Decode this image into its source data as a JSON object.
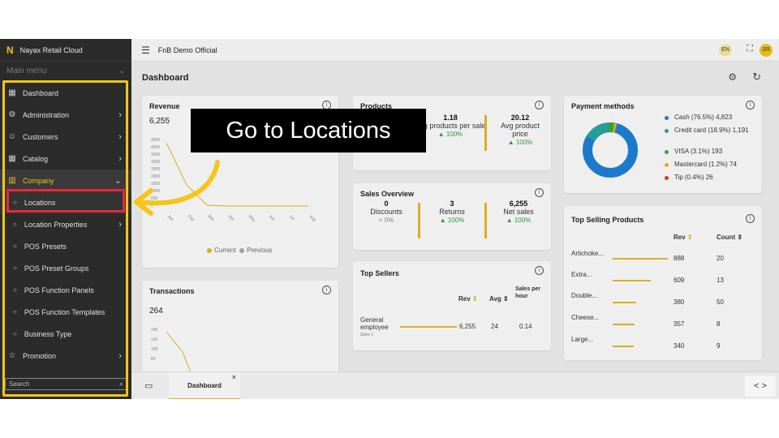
{
  "brand": {
    "logo": "N",
    "name": "Nayax Retail Cloud"
  },
  "sidebar": {
    "main_menu_label": "Main menu",
    "items": [
      {
        "label": "Dashboard",
        "icon": "dashboard-icon",
        "glyph": "▦"
      },
      {
        "label": "Administration",
        "icon": "admin-icon",
        "glyph": "⚙"
      },
      {
        "label": "Customers",
        "icon": "customers-icon",
        "glyph": "☺"
      },
      {
        "label": "Catalog",
        "icon": "catalog-icon",
        "glyph": "▦"
      },
      {
        "label": "Company",
        "icon": "company-icon",
        "glyph": "▥"
      }
    ],
    "sub_items": [
      {
        "label": "Locations"
      },
      {
        "label": "Location Properties"
      },
      {
        "label": "POS Presets"
      },
      {
        "label": "POS Preset Groups"
      },
      {
        "label": "POS Function Panels"
      },
      {
        "label": "POS Function Templates"
      },
      {
        "label": "Business Type"
      }
    ],
    "promotion": {
      "label": "Promotion",
      "icon": "star-icon",
      "glyph": "☆"
    },
    "search_placeholder": "Search"
  },
  "topbar": {
    "org": "FnB Demo Official",
    "lang": "EN",
    "avatar": "SR"
  },
  "page": {
    "title": "Dashboard"
  },
  "revenue": {
    "title": "Revenue",
    "total": "6,255",
    "y_ticks": [
      "4500",
      "4000",
      "3500",
      "3000",
      "2500",
      "2000",
      "1500",
      "1000",
      "500",
      "0"
    ],
    "months": [
      "Jan",
      "Feb",
      "Mar",
      "Apr",
      "May",
      "Jun",
      "Jul",
      "Aug"
    ],
    "legend_current": "Current",
    "legend_previous": "Previous"
  },
  "products": {
    "title": "Products",
    "avg_products": {
      "value": "1.18",
      "label": "Avg products per sale",
      "pct": "▲ 100%"
    },
    "avg_price": {
      "value": "20.12",
      "label": "Avg product price",
      "pct": "▲ 100%"
    }
  },
  "sales_overview": {
    "title": "Sales Overview",
    "discounts": {
      "value": "0",
      "label": "Discounts",
      "pct": "= 0%"
    },
    "returns": {
      "value": "3",
      "label": "Returns",
      "pct": "▲ 100%"
    },
    "net_sales": {
      "value": "6,255",
      "label": "Net sales",
      "pct": "▲ 100%"
    }
  },
  "top_sellers": {
    "title": "Top Sellers",
    "headers": {
      "rev": "Rev",
      "avg": "Avg",
      "sales_per_hour": "Sales per hour"
    },
    "row": {
      "name": "General employee",
      "store": "Store 1",
      "rev": "6,255",
      "avg": "24",
      "sph": "0.14"
    }
  },
  "payment_methods": {
    "title": "Payment methods",
    "items": [
      {
        "label": "Cash (76.5%) 4,823",
        "color": "#1e7fd6"
      },
      {
        "label": "Credit card (18.9%) 1,191",
        "color": "#26a69a"
      },
      {
        "label": "VISA (3.1%) 193",
        "color": "#43a047"
      },
      {
        "label": "Mastercard (1.2%) 74",
        "color": "#e4b620"
      },
      {
        "label": "Tip (0.4%) 26",
        "color": "#e53935"
      }
    ]
  },
  "top_products": {
    "title": "Top Selling Products",
    "headers": {
      "rev": "Rev",
      "count": "Count"
    },
    "rows": [
      {
        "name": "Artichoke...",
        "rev": "888",
        "count": "20"
      },
      {
        "name": "Extra...",
        "rev": "609",
        "count": "13"
      },
      {
        "name": "Double...",
        "rev": "380",
        "count": "50"
      },
      {
        "name": "Cheese...",
        "rev": "357",
        "count": "8"
      },
      {
        "name": "Large...",
        "rev": "340",
        "count": "9"
      }
    ]
  },
  "transactions": {
    "title": "Transactions",
    "total": "264",
    "y_ticks": [
      "140",
      "120",
      "100",
      "80"
    ]
  },
  "bottom": {
    "tab_label": "Dashboard",
    "close": "×",
    "nav": "< >"
  },
  "callout": {
    "text": "Go to Locations"
  },
  "colors": {
    "highlight": "#f5c518",
    "focus": "#e8283c",
    "accent": "#e4b620"
  }
}
